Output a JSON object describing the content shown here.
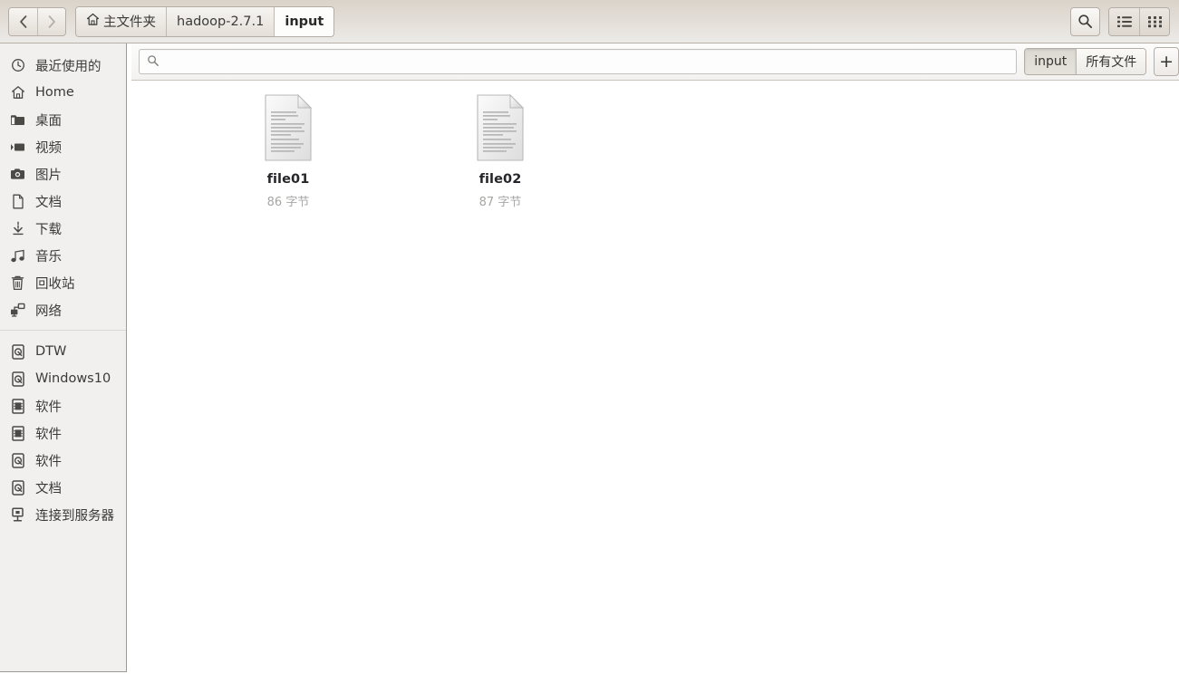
{
  "header": {
    "nav": {
      "back_label": "‹",
      "forward_label": "›",
      "back_name": "back-button",
      "forward_name": "forward-button"
    },
    "breadcrumb": [
      {
        "label": "主文件夹",
        "icon": "home-icon",
        "active": false
      },
      {
        "label": "hadoop-2.7.1",
        "icon": "",
        "active": false
      },
      {
        "label": "input",
        "icon": "",
        "active": true
      }
    ],
    "buttons": {
      "search_icon": "search-icon",
      "list_view_icon": "list-view-icon",
      "grid_view_icon": "grid-view-icon"
    }
  },
  "search": {
    "value": "",
    "placeholder": "",
    "icon": "search-icon"
  },
  "location_tabs": {
    "items": [
      {
        "label": "input",
        "pressed": true
      },
      {
        "label": "所有文件",
        "pressed": false
      }
    ],
    "add_label": "+"
  },
  "sidebar": {
    "groups": [
      {
        "items": [
          {
            "label": "最近使用的",
            "icon": "clock-icon"
          },
          {
            "label": "Home",
            "icon": "home-icon"
          },
          {
            "label": "桌面",
            "icon": "folder-icon"
          },
          {
            "label": "视频",
            "icon": "video-icon"
          },
          {
            "label": "图片",
            "icon": "camera-icon"
          },
          {
            "label": "文档",
            "icon": "document-icon"
          },
          {
            "label": "下载",
            "icon": "download-icon"
          },
          {
            "label": "音乐",
            "icon": "music-icon"
          },
          {
            "label": "回收站",
            "icon": "trash-icon"
          },
          {
            "label": "网络",
            "icon": "network-icon"
          }
        ]
      },
      {
        "items": [
          {
            "label": "DTW",
            "icon": "harddisk-icon"
          },
          {
            "label": "Windows10",
            "icon": "harddisk-icon"
          },
          {
            "label": "软件",
            "icon": "drive-removable-icon"
          },
          {
            "label": "软件",
            "icon": "drive-removable-icon"
          },
          {
            "label": "软件",
            "icon": "harddisk-icon"
          },
          {
            "label": "文档",
            "icon": "harddisk-icon"
          },
          {
            "label": "连接到服务器",
            "icon": "server-connect-icon"
          }
        ]
      }
    ]
  },
  "files": [
    {
      "name": "file01",
      "size": "86 字节",
      "icon": "text-document-icon"
    },
    {
      "name": "file02",
      "size": "87 字节",
      "icon": "text-document-icon"
    }
  ],
  "colors": {
    "header_top": "#dad3ca",
    "header_bottom": "#ecebe8",
    "sidebar_bg": "#f1f0ee",
    "content_bg": "#ffffff",
    "text": "#3a3a38",
    "muted_text": "#a6a6a4"
  }
}
